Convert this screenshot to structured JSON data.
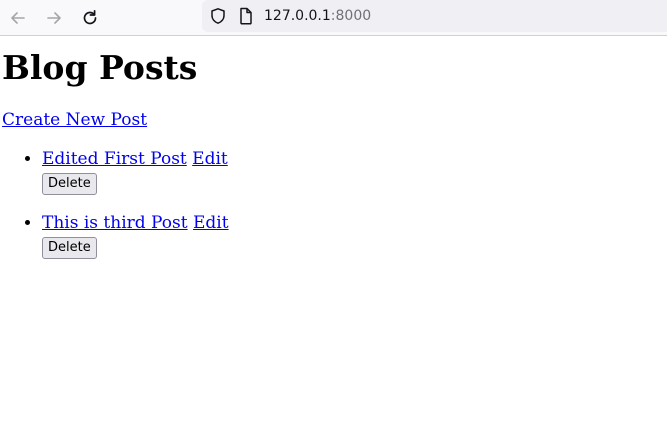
{
  "browser": {
    "url_host": "127.0.0.1",
    "url_port": ":8000",
    "back_icon": "arrow-left-icon",
    "forward_icon": "arrow-right-icon",
    "reload_icon": "reload-icon"
  },
  "page": {
    "title": "Blog Posts",
    "create_link": "Create New Post",
    "posts": [
      {
        "title": "Edited First Post",
        "edit_label": "Edit",
        "delete_label": "Delete"
      },
      {
        "title": "This is third Post",
        "edit_label": "Edit",
        "delete_label": "Delete"
      }
    ]
  }
}
